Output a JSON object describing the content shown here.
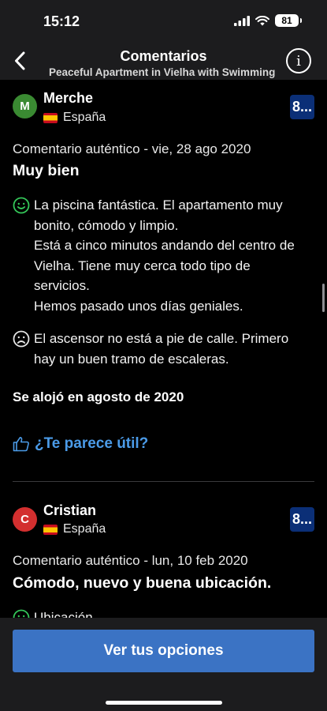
{
  "status": {
    "time": "15:12",
    "battery": "81"
  },
  "nav": {
    "title": "Comentarios",
    "subtitle": "Peaceful Apartment in Vielha with Swimming"
  },
  "reviews": [
    {
      "initial": "M",
      "avatar_color": "#3a8a32",
      "name": "Merche",
      "country": "España",
      "score": "8...",
      "meta": "Comentario auténtico - vie, 28 ago 2020",
      "headline": "Muy bien",
      "positive": [
        "La piscina fantástica. El apartamento muy",
        "bonito, cómodo y limpio.",
        "Está a cinco minutos andando del centro de",
        "Vielha. Tiene muy cerca todo tipo de",
        "servicios.",
        "Hemos pasado unos días geniales."
      ],
      "negative": [
        "El ascensor no está a pie de calle. Primero",
        "hay un buen tramo de escaleras."
      ],
      "stay": "Se alojó en agosto de 2020",
      "helpful": "¿Te parece útil?"
    },
    {
      "initial": "C",
      "avatar_color": "#d32f2f",
      "name": "Cristian",
      "country": "España",
      "score": "8...",
      "meta": "Comentario auténtico - lun, 10 feb 2020",
      "headline": "Cómodo, nuevo y buena ubicación.",
      "positive_partial": "Ubicación"
    }
  ],
  "cta": "Ver tus opciones",
  "colors": {
    "accent": "#3b73c4",
    "link": "#4b9be8",
    "positive": "#34c759",
    "score_bg": "#0b2f77"
  }
}
